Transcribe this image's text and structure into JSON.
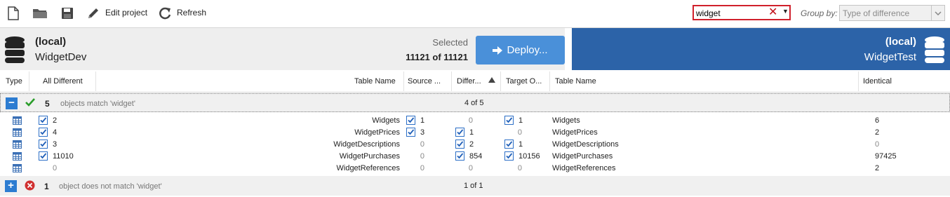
{
  "toolbar": {
    "new_icon": "new-document-icon",
    "open_icon": "open-folder-icon",
    "save_icon": "save-disk-icon",
    "edit_project_label": "Edit project",
    "refresh_label": "Refresh",
    "search_value": "widget",
    "group_by_label": "Group by:",
    "group_by_value": "Type of difference"
  },
  "source": {
    "server": "(local)",
    "database": "WidgetDev"
  },
  "target": {
    "server": "(local)",
    "database": "WidgetTest"
  },
  "selection": {
    "label": "Selected",
    "count": "11121 of 11121"
  },
  "deploy_label": "Deploy...",
  "columns": {
    "type": "Type",
    "all_different": "All Different",
    "table_name_left": "Table Name",
    "source_only": "Source ...",
    "different": "Differ...",
    "target_only": "Target O...",
    "table_name_right": "Table Name",
    "identical": "Identical"
  },
  "groups": [
    {
      "count": "5",
      "text": "objects match 'widget'",
      "page": "4 of 5",
      "expanded": true
    },
    {
      "count": "1",
      "text": "object does not match 'widget'",
      "page": "1 of 1",
      "expanded": false
    }
  ],
  "rows": [
    {
      "all_diff": "2",
      "all_diff_checked": true,
      "name_left": "Widgets",
      "source_only": "1",
      "source_checked": true,
      "different": "0",
      "diff_checked": false,
      "target_only": "1",
      "target_checked": true,
      "name_right": "Widgets",
      "identical": "6"
    },
    {
      "all_diff": "4",
      "all_diff_checked": true,
      "name_left": "WidgetPrices",
      "source_only": "3",
      "source_checked": true,
      "different": "1",
      "diff_checked": true,
      "target_only": "0",
      "target_checked": false,
      "name_right": "WidgetPrices",
      "identical": "2"
    },
    {
      "all_diff": "3",
      "all_diff_checked": true,
      "name_left": "WidgetDescriptions",
      "source_only": "0",
      "source_checked": false,
      "different": "2",
      "diff_checked": true,
      "target_only": "1",
      "target_checked": true,
      "name_right": "WidgetDescriptions",
      "identical": "0"
    },
    {
      "all_diff": "11010",
      "all_diff_checked": true,
      "name_left": "WidgetPurchases",
      "source_only": "0",
      "source_checked": false,
      "different": "854",
      "diff_checked": true,
      "target_only": "10156",
      "target_checked": true,
      "name_right": "WidgetPurchases",
      "identical": "97425"
    },
    {
      "all_diff": "0",
      "all_diff_checked": false,
      "name_left": "WidgetReferences",
      "source_only": "0",
      "source_checked": false,
      "different": "0",
      "diff_checked": false,
      "target_only": "0",
      "target_checked": false,
      "name_right": "WidgetReferences",
      "identical": "2"
    }
  ],
  "colors": {
    "accent": "#2c63a8",
    "deploy": "#4a90d9",
    "search_border": "#d0202c",
    "check": "#2a9d2a",
    "error": "#d03030"
  }
}
